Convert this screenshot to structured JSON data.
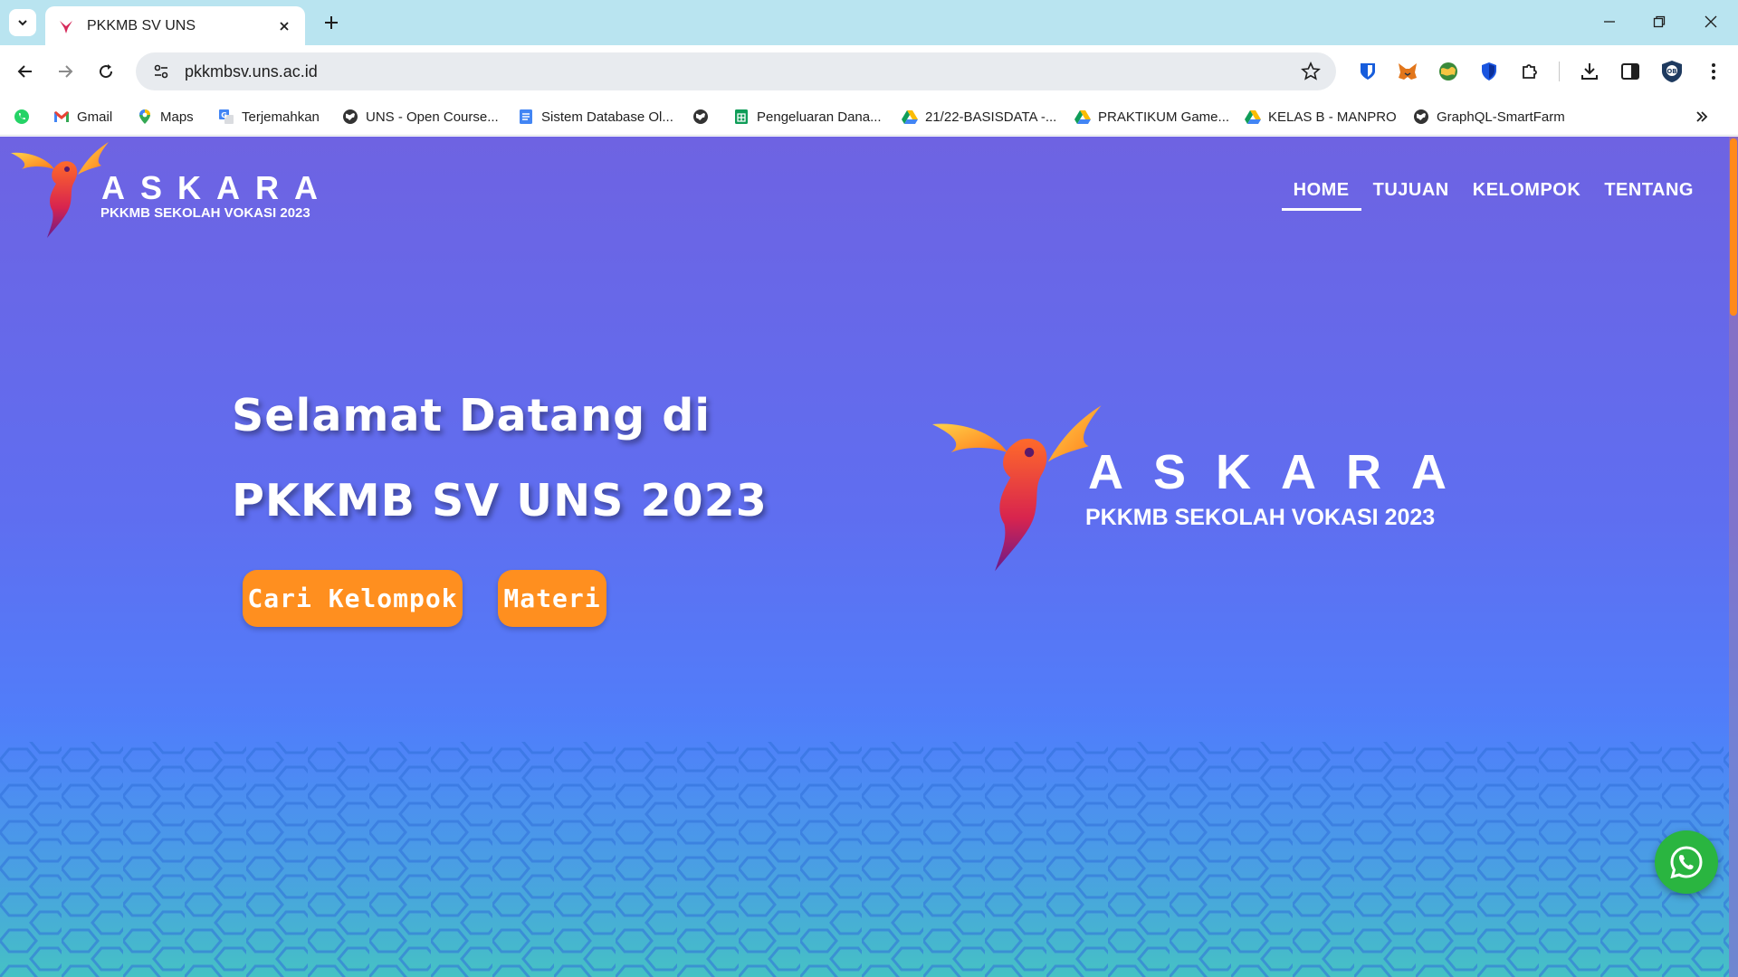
{
  "browser": {
    "tab_title": "PKKMB SV UNS",
    "url": "pkkmbsv.uns.ac.id",
    "bookmarks": [
      {
        "label": "",
        "icon": "whatsapp-icon"
      },
      {
        "label": "Gmail",
        "icon": "gmail-icon"
      },
      {
        "label": "Maps",
        "icon": "maps-pin-icon"
      },
      {
        "label": "Terjemahkan",
        "icon": "translate-icon"
      },
      {
        "label": "UNS - Open Course...",
        "icon": "globe-icon"
      },
      {
        "label": "Sistem Database Ol...",
        "icon": "docs-icon"
      },
      {
        "label": "",
        "icon": "globe-icon"
      },
      {
        "label": "Pengeluaran Dana...",
        "icon": "sheets-icon"
      },
      {
        "label": "21/22-BASISDATA -...",
        "icon": "drive-icon"
      },
      {
        "label": "PRAKTIKUM Game...",
        "icon": "drive-icon"
      },
      {
        "label": "KELAS B - MANPRO",
        "icon": "drive-icon"
      },
      {
        "label": "GraphQL-SmartFarm",
        "icon": "globe-icon"
      }
    ]
  },
  "site": {
    "brand_word": "ASKARA",
    "brand_sub": "PKKMB SEKOLAH VOKASI 2023",
    "nav": [
      "HOME",
      "TUJUAN",
      "KELOMPOK",
      "TENTANG"
    ],
    "active_nav": "HOME",
    "hero_line1": "Selamat Datang di",
    "hero_line2": "PKKMB SV UNS 2023",
    "btn_primary": "Cari Kelompok",
    "btn_secondary": "Materi"
  },
  "colors": {
    "accent_orange": "#ff8f1f",
    "bg_top": "#6e63e2",
    "bg_bottom": "#4a86f5",
    "whatsapp_green": "#2ab540"
  }
}
